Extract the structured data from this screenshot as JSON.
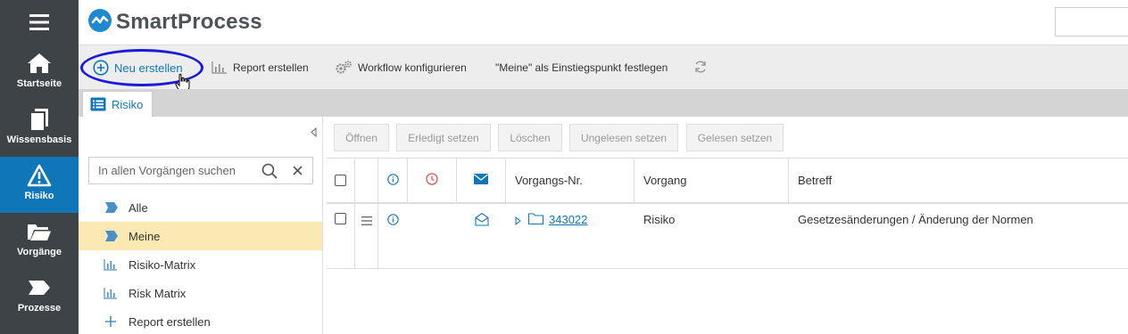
{
  "app": {
    "name": "SmartProcess"
  },
  "nav": {
    "items": [
      {
        "label": "Startseite",
        "icon": "home-icon"
      },
      {
        "label": "Wissensbasis",
        "icon": "documents-icon"
      },
      {
        "label": "Risiko",
        "icon": "warning-icon",
        "active": true
      },
      {
        "label": "Vorgänge",
        "icon": "folder-icon"
      },
      {
        "label": "Prozesse",
        "icon": "process-arrow-icon"
      }
    ]
  },
  "toolbar": {
    "new_label": "Neu erstellen",
    "report_label": "Report erstellen",
    "workflow_label": "Workflow konfigurieren",
    "entrypoint_label": "\"Meine\" als Einstiegspunkt festlegen"
  },
  "tab": {
    "label": "Risiko"
  },
  "leftpanel": {
    "search_placeholder": "In allen Vorgängen suchen",
    "items": [
      {
        "label": "Alle",
        "icon": "tag-icon"
      },
      {
        "label": "Meine",
        "icon": "tag-icon",
        "active": true
      },
      {
        "label": "Risiko-Matrix",
        "icon": "bar-chart-icon"
      },
      {
        "label": "Risk Matrix",
        "icon": "bar-chart-icon"
      },
      {
        "label": "Report erstellen",
        "icon": "plus-icon"
      }
    ]
  },
  "actions": {
    "open": "Öffnen",
    "done": "Erledigt setzen",
    "delete": "Löschen",
    "unread": "Ungelesen setzen",
    "read": "Gelesen setzen"
  },
  "table": {
    "headers": {
      "number": "Vorgangs-Nr.",
      "process": "Vorgang",
      "subject": "Betreff"
    },
    "rows": [
      {
        "number": "343022",
        "process": "Risiko",
        "subject": "Gesetzesänderungen / Änderung der Normen"
      }
    ]
  },
  "colors": {
    "accent": "#0f77b8",
    "nav_bg": "#3d4347",
    "active_row": "#fbe8b2",
    "highlight_ring": "#1a1adb"
  }
}
